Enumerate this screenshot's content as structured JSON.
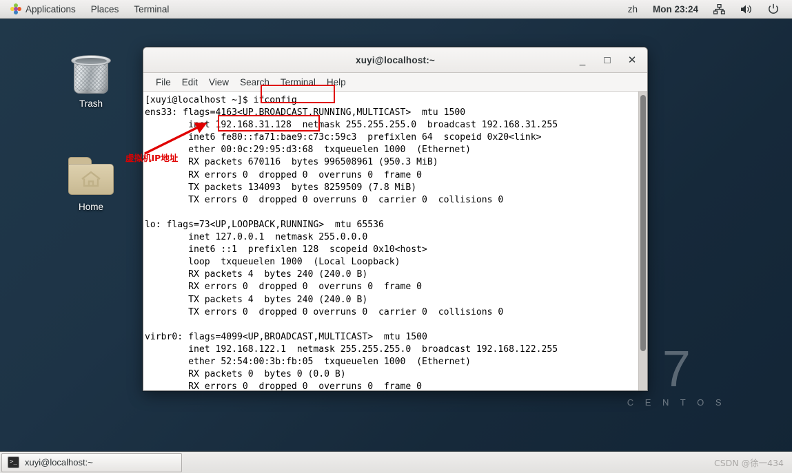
{
  "top_panel": {
    "applications": "Applications",
    "places": "Places",
    "terminal": "Terminal",
    "language": "zh",
    "clock": "Mon 23:24",
    "icons": [
      "network-icon",
      "volume-icon",
      "power-icon"
    ]
  },
  "desktop": {
    "icons": [
      {
        "name": "trash",
        "label": "Trash"
      },
      {
        "name": "home",
        "label": "Home"
      }
    ],
    "brand": {
      "version": "7",
      "name": "C E N T O S"
    }
  },
  "terminal": {
    "title": "xuyi@localhost:~",
    "menu": [
      "File",
      "Edit",
      "View",
      "Search",
      "Terminal",
      "Help"
    ],
    "controls": {
      "minimize": "_",
      "maximize": "□",
      "close": "✕"
    },
    "content": "[xuyi@localhost ~]$ ifconfig\nens33: flags=4163<UP,BROADCAST,RUNNING,MULTICAST>  mtu 1500\n        inet 192.168.31.128  netmask 255.255.255.0  broadcast 192.168.31.255\n        inet6 fe80::fa71:bae9:c73c:59c3  prefixlen 64  scopeid 0x20<link>\n        ether 00:0c:29:95:d3:68  txqueuelen 1000  (Ethernet)\n        RX packets 670116  bytes 996508961 (950.3 MiB)\n        RX errors 0  dropped 0  overruns 0  frame 0\n        TX packets 134093  bytes 8259509 (7.8 MiB)\n        TX errors 0  dropped 0 overruns 0  carrier 0  collisions 0\n\nlo: flags=73<UP,LOOPBACK,RUNNING>  mtu 65536\n        inet 127.0.0.1  netmask 255.0.0.0\n        inet6 ::1  prefixlen 128  scopeid 0x10<host>\n        loop  txqueuelen 1000  (Local Loopback)\n        RX packets 4  bytes 240 (240.0 B)\n        RX errors 0  dropped 0  overruns 0  frame 0\n        TX packets 4  bytes 240 (240.0 B)\n        TX errors 0  dropped 0 overruns 0  carrier 0  collisions 0\n\nvirbr0: flags=4099<UP,BROADCAST,MULTICAST>  mtu 1500\n        inet 192.168.122.1  netmask 255.255.255.0  broadcast 192.168.122.255\n        ether 52:54:00:3b:fb:05  txqueuelen 1000  (Ethernet)\n        RX packets 0  bytes 0 (0.0 B)\n        RX errors 0  dropped 0  overruns 0  frame 0"
  },
  "annotations": {
    "command_highlight": "ifconfig",
    "ip_highlight": "192.168.31.128",
    "arrow_label": "虚拟机IP地址",
    "color": "#e00000"
  },
  "bottom_panel": {
    "task_label": "xuyi@localhost:~",
    "watermark": "CSDN @徐一434"
  }
}
